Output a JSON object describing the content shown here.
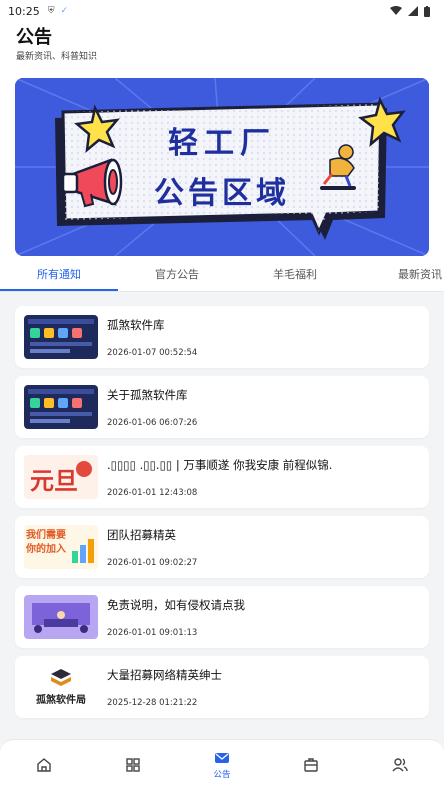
{
  "statusbar": {
    "time": "10:25"
  },
  "header": {
    "title": "公告",
    "subtitle": "最新资讯、科普知识"
  },
  "banner": {
    "line1": "轻工厂",
    "line2": "公告区域"
  },
  "tabs": [
    {
      "label": "所有通知",
      "active": true
    },
    {
      "label": "官方公告",
      "active": false
    },
    {
      "label": "羊毛福利",
      "active": false
    },
    {
      "label": "最新资讯",
      "active": false
    }
  ],
  "items": [
    {
      "title": "孤煞软件库",
      "date": "2026-01-07 00:52:54",
      "thumb": "app-screenshot"
    },
    {
      "title": "关于孤煞软件库",
      "date": "2026-01-06 06:07:26",
      "thumb": "app-screenshot"
    },
    {
      "title": ".▯▯▯▯ .▯▯.▯▯ | 万事顺遂  你我安康  前程似锦.",
      "date": "2026-01-01 12:43:08",
      "thumb": "new-year"
    },
    {
      "title": "团队招募精英",
      "date": "2026-01-01 09:02:27",
      "thumb": "recruit"
    },
    {
      "title": "免责说明，如有侵权请点我",
      "date": "2026-01-01 09:01:13",
      "thumb": "meeting"
    },
    {
      "title": "大量招募网络精英绅士",
      "date": "2025-12-28 01:21:22",
      "thumb": "logo"
    }
  ],
  "thumb_texts": {
    "newyear": "元旦",
    "recruit": "我们需要你的加入",
    "logo": "孤煞软件局"
  },
  "bottomnav": [
    {
      "icon": "home-icon",
      "label": ""
    },
    {
      "icon": "grid-icon",
      "label": ""
    },
    {
      "icon": "mail-icon",
      "label": "公告",
      "active": true
    },
    {
      "icon": "box-icon",
      "label": ""
    },
    {
      "icon": "users-icon",
      "label": ""
    }
  ],
  "colors": {
    "accent": "#2563eb",
    "banner_blue": "#3956d4",
    "banner_text": "#1f2f9e",
    "star": "#ffe14a"
  }
}
